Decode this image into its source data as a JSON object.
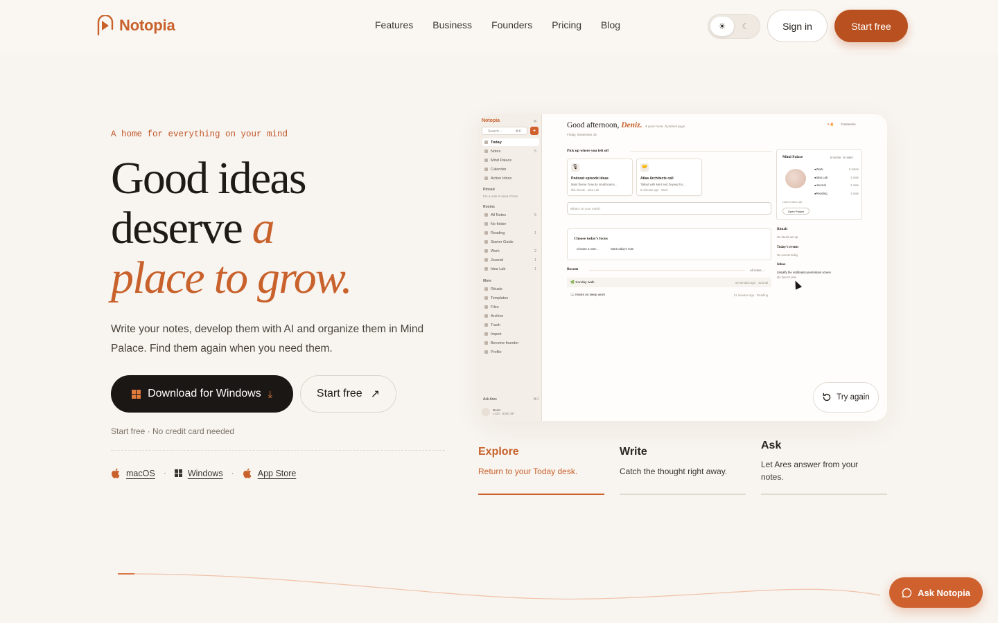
{
  "brand": {
    "name": "Notopia",
    "accent": "#c8612b",
    "dark": "#1b1714"
  },
  "nav": {
    "items": [
      "Features",
      "Business",
      "Founders",
      "Pricing",
      "Blog"
    ],
    "theme_light_icon": "☀",
    "theme_dark_icon": "☾",
    "signin_label": "Sign in",
    "startfree_label": "Start free"
  },
  "hero": {
    "eyebrow": "A home for everything on your mind",
    "headline_line1": "Good ideas",
    "headline_line2_plain": "deserve ",
    "headline_line2_accent": "a",
    "headline_line3_accent": "place to grow.",
    "subtext": "Write your notes, develop them with AI and organize them in Mind Palace. Find them again when you need them.",
    "download_label": "Download for Windows",
    "startfree_label": "Start free",
    "note": "Start free · No credit card needed",
    "platforms": [
      "macOS",
      "Windows",
      "App Store"
    ]
  },
  "preview": {
    "logo": "Notopia",
    "search_placeholder": "Search...",
    "search_shortcut": "⌘K",
    "nav": [
      {
        "label": "Today",
        "count": ""
      },
      {
        "label": "Notes",
        "count": "5"
      },
      {
        "label": "Mind Palace",
        "count": ""
      },
      {
        "label": "Calendar",
        "count": ""
      },
      {
        "label": "Action Inbox",
        "count": ""
      }
    ],
    "pinned_heading": "Pinned",
    "pinned_hint": "Pin a note to keep it here",
    "rooms_heading": "Rooms",
    "rooms": [
      {
        "label": "All Notes",
        "count": "5"
      },
      {
        "label": "No folder",
        "count": ""
      },
      {
        "label": "Reading",
        "count": "1"
      },
      {
        "label": "Starter Guide",
        "count": ""
      },
      {
        "label": "Work",
        "count": "2"
      },
      {
        "label": "Journal",
        "count": "1"
      },
      {
        "label": "Idea Lab",
        "count": "1"
      }
    ],
    "more_heading": "More",
    "more": [
      "Rituals",
      "Templates",
      "Files",
      "Archive",
      "Trash",
      "Import",
      "Become founder",
      "Profile"
    ],
    "ask_ares": "Ask Ares",
    "ask_shortcut": "⌘J",
    "profile_name": "Deniz",
    "profile_meta": "Lv10 · 5200 XP",
    "greeting_prefix": "Good afternoon, ",
    "greeting_name": "Deniz.",
    "greeting_tag": "A quiet room. A patient page.",
    "date": "Friday, September 25",
    "topright_badge": "6 🔥",
    "customize": "Customize",
    "pickup_heading": "Pick up where you left off",
    "cards": [
      {
        "emoji": "🎙",
        "title": "Podcast episode ideas",
        "desc": "Main theme: how do small teams...",
        "meta": "this minute · Idea Lab"
      },
      {
        "emoji": "🤝",
        "title": "Atlas Architects call",
        "desc": "Talked with Mert and Zeynep for...",
        "meta": "6 minutes ago · Work"
      }
    ],
    "input_placeholder": "What's on your mind?",
    "focus_title": "Choose today's focus",
    "focus_a": "Choose a note...",
    "focus_b": "Start today's note",
    "recent_heading": "Recent",
    "all_notes": "All notes →",
    "recent": [
      {
        "title": "🌿 Sunday walk",
        "meta": "19 minutes ago · Journal"
      },
      {
        "title": "📖 Notes on deep work",
        "meta": "21 minutes ago · Reading"
      }
    ],
    "palace_title": "Mind Palace",
    "palace_meta": "5 rooms · 5 notes",
    "palace_rooms": [
      {
        "label": "Work",
        "count": "2 notes"
      },
      {
        "label": "Idea Lab",
        "count": "1 note"
      },
      {
        "label": "Journal",
        "count": "1 note"
      },
      {
        "label": "Reading",
        "count": "1 note"
      }
    ],
    "palace_last": "Last in Idea Lab",
    "palace_open": "Open Palace",
    "rituals_heading": "Rituals",
    "rituals_sub": "No rituals set up.",
    "events_heading": "Today's events",
    "events_sub": "No events today.",
    "inbox_heading": "Inbox",
    "inbox_item": "Simplify the notification permission screen",
    "inbox_sub": "Q4 launch plan",
    "try_again": "Try again"
  },
  "features": [
    {
      "title": "Explore",
      "desc": "Return to your Today desk."
    },
    {
      "title": "Write",
      "desc": "Catch the thought right away."
    },
    {
      "title": "Ask",
      "desc": "Let Ares answer from your notes."
    }
  ],
  "ask_button": "Ask Notopia"
}
